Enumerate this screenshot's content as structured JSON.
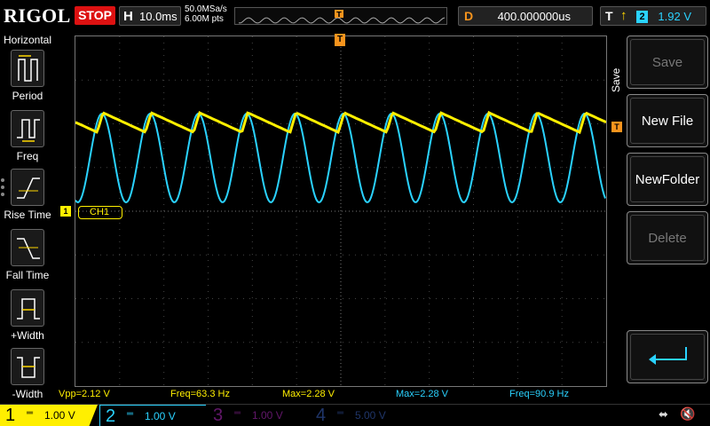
{
  "header": {
    "logo": "RIGOL",
    "run_state": "STOP",
    "horizontal_label": "H",
    "timebase": "10.0ms",
    "sample_rate": "50.0MSa/s",
    "memory_depth": "6.00M pts",
    "delay_label": "D",
    "delay_value": "400.000000us",
    "trigger_label": "T",
    "trigger_source": "2",
    "trigger_level": "1.92 V"
  },
  "left_menu": {
    "title": "Horizontal",
    "items": [
      {
        "label": "Period",
        "icon": "period-icon"
      },
      {
        "label": "Freq",
        "icon": "frequency-icon"
      },
      {
        "label": "Rise Time",
        "icon": "rise-time-icon"
      },
      {
        "label": "Fall Time",
        "icon": "fall-time-icon"
      },
      {
        "label": "+Width",
        "icon": "positive-width-icon"
      },
      {
        "label": "-Width",
        "icon": "negative-width-icon"
      }
    ]
  },
  "channel_tag": "CH1",
  "channel_marker": "1",
  "measurements": [
    {
      "text": "Vpp=2.12 V",
      "channel": 1
    },
    {
      "text": "Freq=63.3 Hz",
      "channel": 1
    },
    {
      "text": "Max=2.28 V",
      "channel": 1
    },
    {
      "text": "Max=2.28 V",
      "channel": 2
    },
    {
      "text": "Freq=90.9 Hz",
      "channel": 2
    }
  ],
  "right_menu": {
    "title": "Save",
    "buttons": [
      {
        "label": "Save",
        "enabled": false
      },
      {
        "label": "New File",
        "enabled": true
      },
      {
        "label": "NewFolder",
        "enabled": true
      },
      {
        "label": "Delete",
        "enabled": false
      }
    ]
  },
  "channels": [
    {
      "num": "1",
      "scale": "1.00 V",
      "color": "#ffef00",
      "active": true
    },
    {
      "num": "2",
      "scale": "1.00 V",
      "color": "#2ad2ff",
      "active": true
    },
    {
      "num": "3",
      "scale": "1.00 V",
      "color": "#c12fd1",
      "active": false
    },
    {
      "num": "4",
      "scale": "5.00 V",
      "color": "#3f6bd1",
      "active": false
    }
  ],
  "colors": {
    "ch1": "#ffef00",
    "ch2": "#2ad2ff",
    "trigger": "#f7941d",
    "stop": "#dd1111"
  },
  "waveforms": {
    "ch1_shape": "sawtooth",
    "ch1_cycles": 11,
    "ch2_shape": "sine",
    "ch2_cycles": 11
  }
}
